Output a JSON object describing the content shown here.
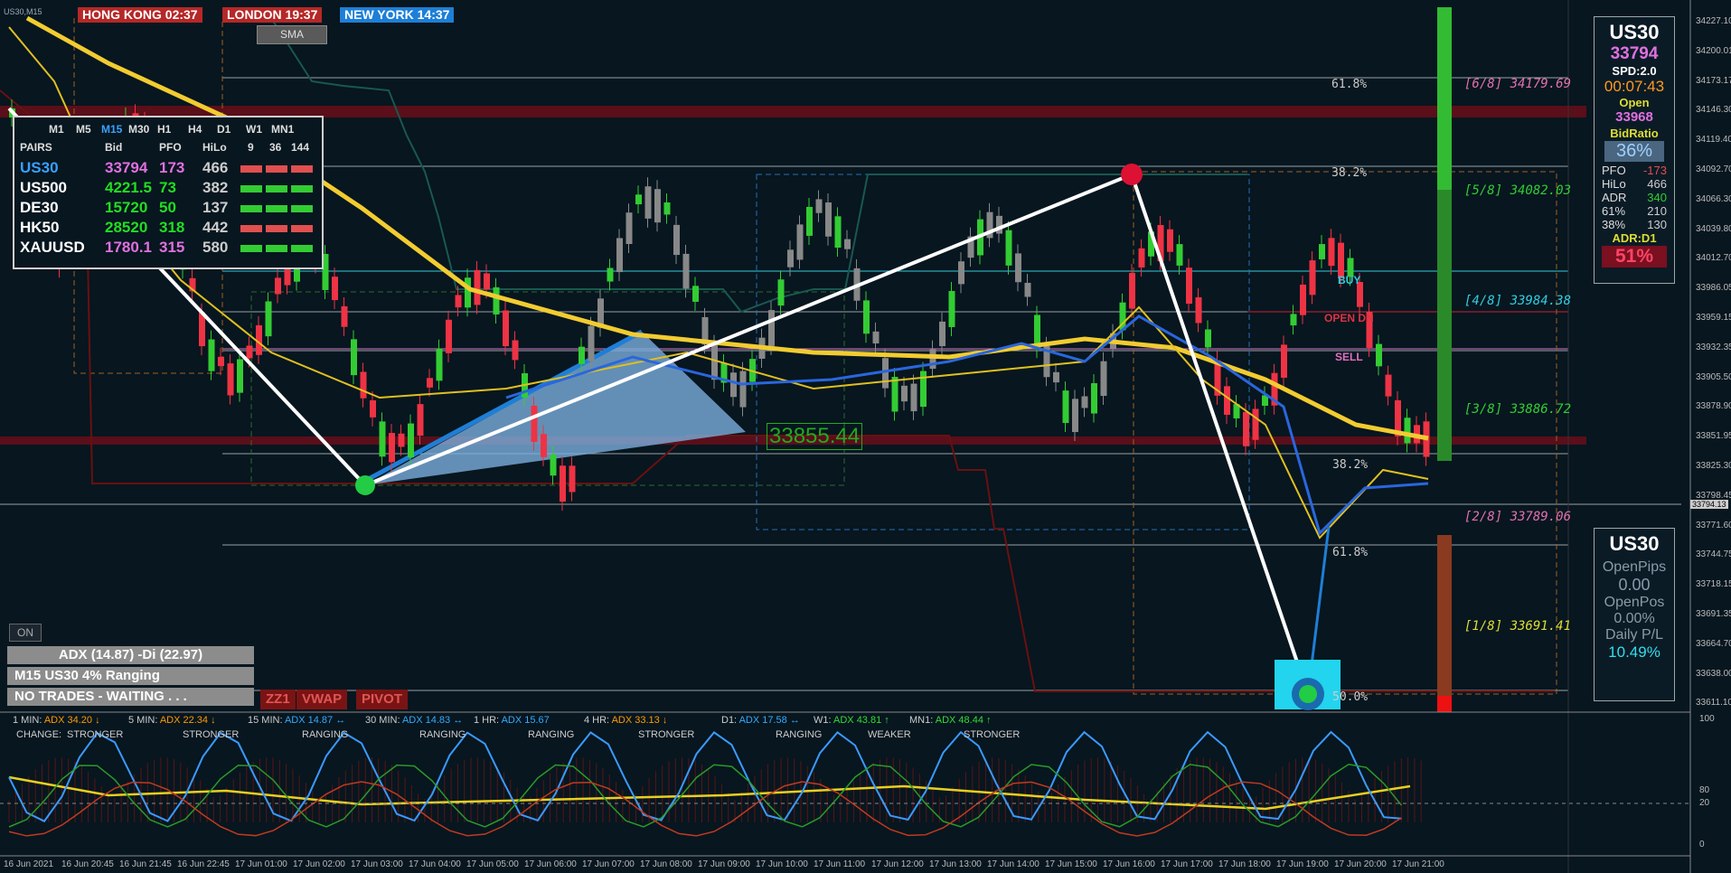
{
  "symbol_tag": "US30,M15",
  "clocks": [
    {
      "city": "HONG KONG",
      "time": "02:37",
      "bg": "#b52828"
    },
    {
      "city": "LONDON",
      "time": "19:37",
      "bg": "#b52828"
    },
    {
      "city": "NEW YORK",
      "time": "14:37",
      "bg": "#1e7fd6"
    }
  ],
  "sma_button": "SMA",
  "pairs_panel": {
    "timeframes": [
      "M1",
      "M5",
      "M15",
      "M30",
      "H1",
      "H4",
      "D1",
      "W1",
      "MN1"
    ],
    "headers": [
      "PAIRS",
      "Bid",
      "PFO",
      "HiLo",
      "9",
      "36",
      "144"
    ],
    "rows": [
      {
        "pair": "US30",
        "bid": "33794",
        "pfo": "173",
        "hilo": "466",
        "pair_color": "#3aa0ff",
        "bid_color": "#e070e0",
        "pfo_color": "#e070e0",
        "bars": [
          "red",
          "red",
          "red"
        ]
      },
      {
        "pair": "US500",
        "bid": "4221.5",
        "pfo": "73",
        "hilo": "382",
        "pair_color": "#ffffff",
        "bid_color": "#22dd22",
        "pfo_color": "#22dd22",
        "bars": [
          "green",
          "green",
          "green"
        ]
      },
      {
        "pair": "DE30",
        "bid": "15720",
        "pfo": "50",
        "hilo": "137",
        "pair_color": "#ffffff",
        "bid_color": "#22dd22",
        "pfo_color": "#22dd22",
        "bars": [
          "green",
          "green",
          "green"
        ]
      },
      {
        "pair": "HK50",
        "bid": "28520",
        "pfo": "318",
        "hilo": "442",
        "pair_color": "#ffffff",
        "bid_color": "#22dd22",
        "pfo_color": "#22dd22",
        "bars": [
          "red",
          "red",
          "red"
        ]
      },
      {
        "pair": "XAUUSD",
        "bid": "1780.1",
        "pfo": "315",
        "hilo": "580",
        "pair_color": "#ffffff",
        "bid_color": "#e070e0",
        "pfo_color": "#e070e0",
        "bars": [
          "green",
          "green",
          "green"
        ]
      }
    ]
  },
  "on_button": "ON",
  "status": {
    "adx": "ADX (14.87)  -Di (22.97)",
    "regime": "M15 US30 4% Ranging",
    "trade": "NO TRADES - WAITING . . ."
  },
  "tool_buttons": [
    "ZZ1",
    "VWAP",
    "PIVOT"
  ],
  "chart_labels": {
    "fib_618_top": "61.8%",
    "fib_382_top": "38.2%",
    "buy": "BUY",
    "open_dn": "OPEN DN",
    "sell": "SELL",
    "fib_382_mid": "38.2%",
    "fib_618_low": "61.8%",
    "fib_bottom": "50.0%",
    "price_box": "33855.44"
  },
  "murrey_levels": [
    {
      "label": "[6/8]",
      "value": "34179.69",
      "color": "#e070b0"
    },
    {
      "label": "[5/8]",
      "value": "34082.03",
      "color": "#33cc33"
    },
    {
      "label": "[4/8]",
      "value": "33984.38",
      "color": "#33ccdd"
    },
    {
      "label": "[3/8]",
      "value": "33886.72",
      "color": "#33cc33"
    },
    {
      "label": "[2/8]",
      "value": "33789.06",
      "color": "#e070b0"
    },
    {
      "label": "[1/8]",
      "value": "33691.41",
      "color": "#dddd33"
    }
  ],
  "info_panel": {
    "symbol": "US30",
    "price": "33794",
    "spread": "SPD:2.0",
    "timer": "00:07:43",
    "open_label": "Open",
    "open_value": "33968",
    "bid_ratio_label": "BidRatio",
    "bid_ratio": "36%",
    "stats": [
      {
        "k": "PFO",
        "v": "-173",
        "vc": "#e05050"
      },
      {
        "k": "HiLo",
        "v": "466",
        "vc": "#cccccc"
      },
      {
        "k": "ADR",
        "v": "340",
        "vc": "#33cc33"
      },
      {
        "k": "61%",
        "v": "210",
        "vc": "#cccccc"
      },
      {
        "k": "38%",
        "v": "130",
        "vc": "#cccccc"
      }
    ],
    "adr_label": "ADR:D1",
    "adr_value": "51%"
  },
  "pl_panel": {
    "symbol": "US30",
    "open_pips_label": "OpenPips",
    "open_pips": "0.00",
    "open_pos_label": "OpenPos",
    "open_pos": "0.00%",
    "daily_pl_label": "Daily P/L",
    "daily_pl": "10.49%"
  },
  "price_axis": [
    "34227.10",
    "34200.01",
    "34173.17",
    "34146.30",
    "34119.40",
    "34092.70",
    "34066.30",
    "34039.80",
    "34012.70",
    "33986.05",
    "33959.15",
    "33932.35",
    "33905.50",
    "33878.90",
    "33851.95",
    "33825.30",
    "33798.45",
    "33771.60",
    "33744.75",
    "33718.15",
    "33691.35",
    "33664.70",
    "33638.00",
    "33611.10"
  ],
  "current_price_tag": "33794.13",
  "indicator_strip": {
    "change_label": "CHANGE:",
    "items": [
      {
        "tf": "1 MIN:",
        "adx": "ADX 34.20",
        "arrow": "↓",
        "color": "#ff9900",
        "state": "STRONGER"
      },
      {
        "tf": "5 MIN:",
        "adx": "ADX 22.34",
        "arrow": "↓",
        "color": "#ff9900",
        "state": "STRONGER"
      },
      {
        "tf": "15 MIN:",
        "adx": "ADX 14.87",
        "arrow": "↔",
        "color": "#33aaff",
        "state": "RANGING"
      },
      {
        "tf": "30 MIN:",
        "adx": "ADX 14.83",
        "arrow": "↔",
        "color": "#33aaff",
        "state": "RANGING"
      },
      {
        "tf": "1 HR:",
        "adx": "ADX 15.67",
        "arrow": "",
        "color": "#33aaff",
        "state": "RANGING"
      },
      {
        "tf": "4 HR:",
        "adx": "ADX 33.13",
        "arrow": "↓",
        "color": "#ff9900",
        "state": "STRONGER"
      },
      {
        "tf": "D1:",
        "adx": "ADX 17.58",
        "arrow": "↔",
        "color": "#33aaff",
        "state": "RANGING"
      },
      {
        "tf": "W1:",
        "adx": "ADX 43.81",
        "arrow": "↑",
        "color": "#33dd33",
        "state": "WEAKER"
      },
      {
        "tf": "MN1:",
        "adx": "ADX 48.44",
        "arrow": "↑",
        "color": "#33dd33",
        "state": "STRONGER"
      }
    ]
  },
  "osc_axis": [
    "100",
    "80",
    "20",
    "0"
  ],
  "time_axis": [
    "16 Jun 2021",
    "16 Jun 20:45",
    "16 Jun 21:45",
    "16 Jun 22:45",
    "17 Jun 01:00",
    "17 Jun 02:00",
    "17 Jun 03:00",
    "17 Jun 04:00",
    "17 Jun 05:00",
    "17 Jun 06:00",
    "17 Jun 07:00",
    "17 Jun 08:00",
    "17 Jun 09:00",
    "17 Jun 10:00",
    "17 Jun 11:00",
    "17 Jun 12:00",
    "17 Jun 13:00",
    "17 Jun 14:00",
    "17 Jun 15:00",
    "17 Jun 16:00",
    "17 Jun 17:00",
    "17 Jun 18:00",
    "17 Jun 19:00",
    "17 Jun 20:00",
    "17 Jun 21:00"
  ]
}
